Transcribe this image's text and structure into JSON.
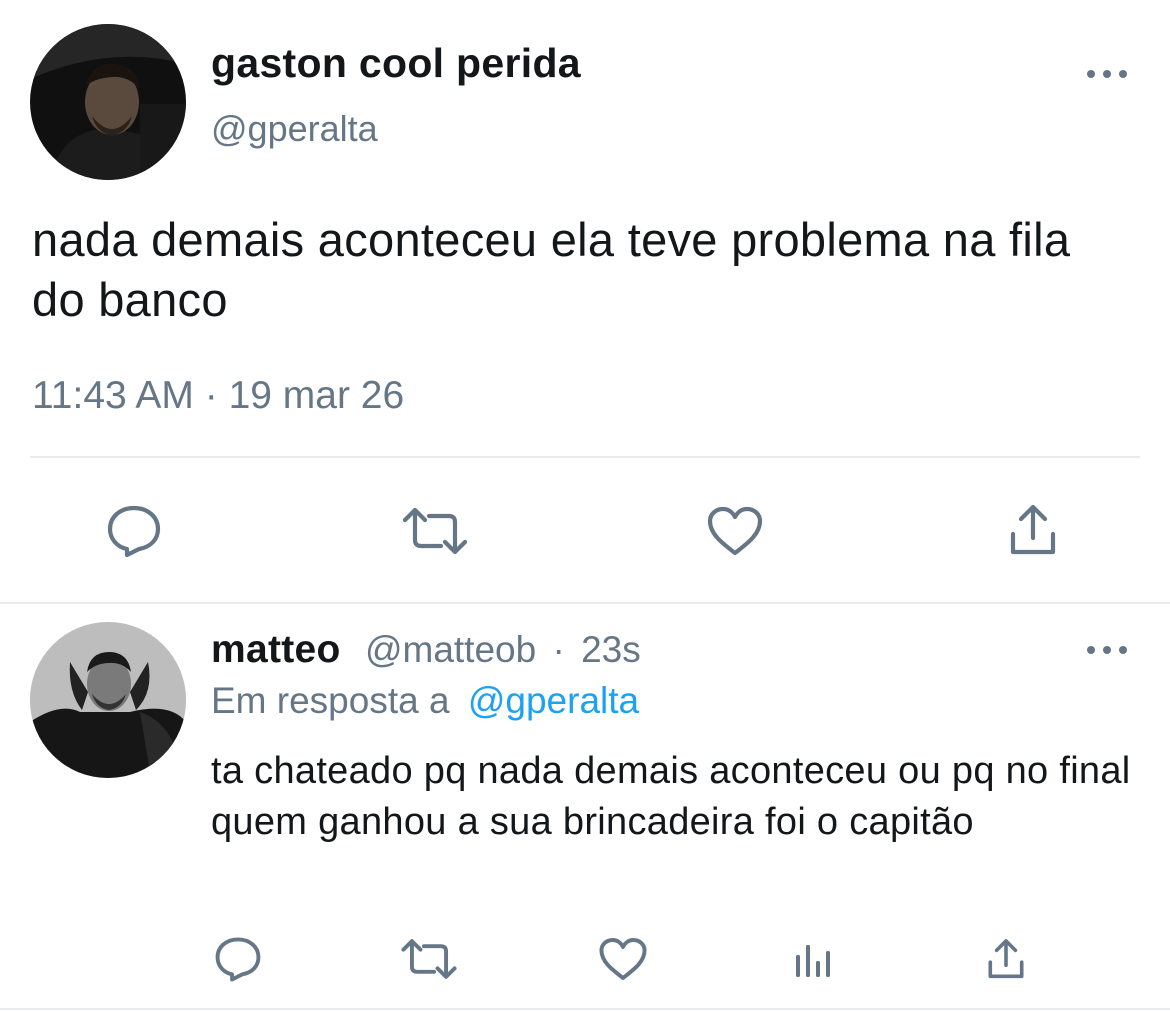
{
  "tweet": {
    "author_name": "gaston cool perida",
    "author_handle": "@gperalta",
    "text": "nada demais aconteceu ela teve problema na fila do banco",
    "time": "11:43 AM",
    "separator": "·",
    "date": "19 mar 26",
    "actions": [
      "reply-icon",
      "retweet-icon",
      "like-icon",
      "share-icon"
    ]
  },
  "reply": {
    "author_name": "matteo",
    "author_handle": "@matteob",
    "separator": "·",
    "age": "23s",
    "replying_to_prefix": "Em resposta a",
    "replying_to_handle": "@gperalta",
    "text": "ta chateado pq nada demais aconteceu ou pq no final quem ganhou a sua brincadeira foi o capitão",
    "actions": [
      "reply-icon",
      "retweet-icon",
      "like-icon",
      "analytics-icon",
      "share-icon"
    ]
  },
  "colors": {
    "primary_text": "#14171a",
    "secondary_text": "#657786",
    "link": "#1da1f2",
    "divider": "#e6ecf0"
  }
}
